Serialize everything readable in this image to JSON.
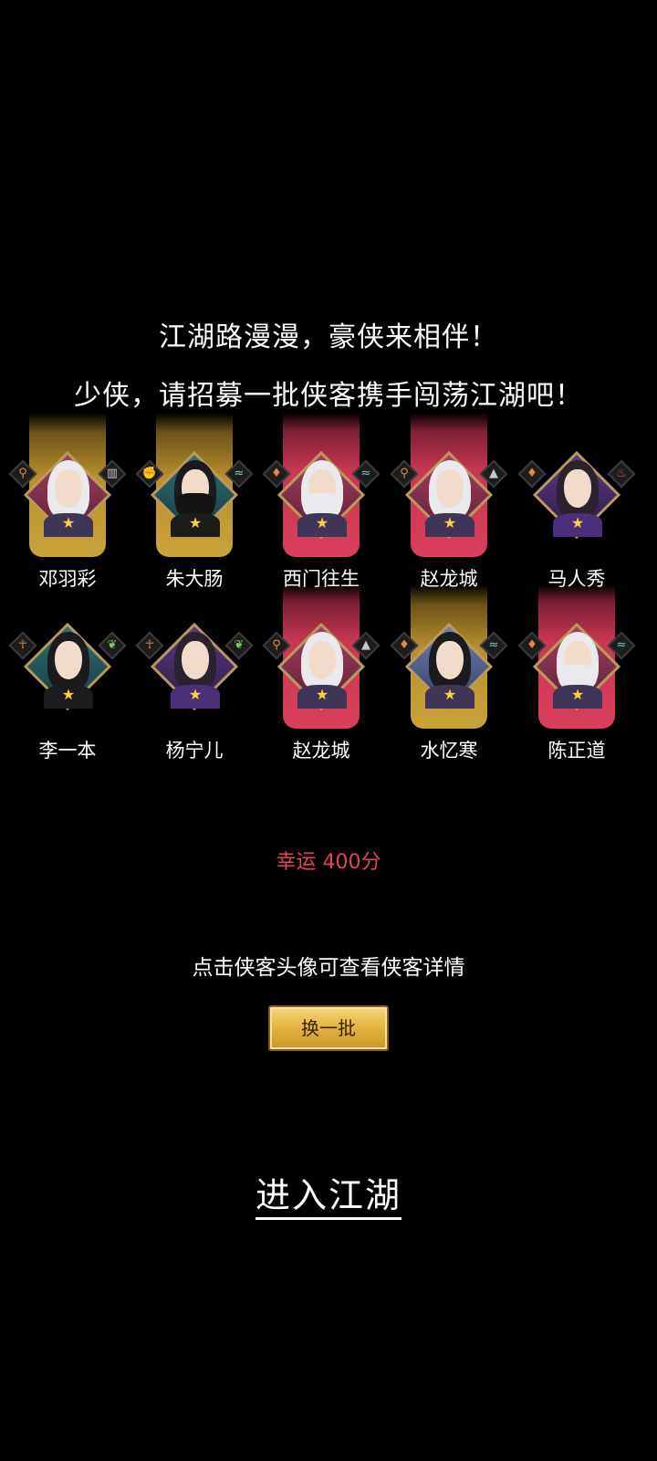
{
  "header": {
    "line1": "江湖路漫漫，豪侠来相伴！",
    "line2": "少侠，请招募一批侠客携手闯荡江湖吧！"
  },
  "heroes": [
    {
      "name": "邓羽彩",
      "banner": "gold",
      "frame": "pink",
      "hair": "white",
      "left_icon": "location-icon",
      "right_icon": "bars-icon"
    },
    {
      "name": "朱大肠",
      "banner": "gold",
      "frame": "teal",
      "hair": "black",
      "left_icon": "fist-icon",
      "right_icon": "wave-icon"
    },
    {
      "name": "西门往生",
      "banner": "red",
      "frame": "pink",
      "hair": "white",
      "left_icon": "flame-drop-icon",
      "right_icon": "wave-icon"
    },
    {
      "name": "赵龙城",
      "banner": "red",
      "frame": "pink",
      "hair": "white",
      "left_icon": "location-icon",
      "right_icon": "mountain-icon"
    },
    {
      "name": "马人秀",
      "banner": "none",
      "frame": "purple",
      "hair": "dark",
      "left_icon": "flame-drop-icon",
      "right_icon": "fire-icon"
    },
    {
      "name": "李一本",
      "banner": "none",
      "frame": "teal",
      "hair": "black",
      "left_icon": "figure-icon",
      "right_icon": "leaf-icon"
    },
    {
      "name": "杨宁儿",
      "banner": "none",
      "frame": "purple",
      "hair": "dark",
      "left_icon": "figure-icon",
      "right_icon": "leaf-icon"
    },
    {
      "name": "赵龙城",
      "banner": "red",
      "frame": "pink",
      "hair": "white",
      "left_icon": "location-icon",
      "right_icon": "mountain-icon"
    },
    {
      "name": "水忆寒",
      "banner": "gold",
      "frame": "blue",
      "hair": "black",
      "left_icon": "flame-drop-icon",
      "right_icon": "wave-icon"
    },
    {
      "name": "陈正道",
      "banner": "red",
      "frame": "pink",
      "hair": "white",
      "left_icon": "flame-drop-icon",
      "right_icon": "wave-icon"
    }
  ],
  "luck_text": "幸运 400分",
  "hint_text": "点击侠客头像可查看侠客详情",
  "swap_button": "换一批",
  "enter_button": "进入江湖",
  "colors": {
    "background": "#000000",
    "banner_gold": "#caa33a",
    "banner_red": "#d93f5d",
    "luck_text": "#e8425a",
    "button_gold": "#e6b545"
  }
}
